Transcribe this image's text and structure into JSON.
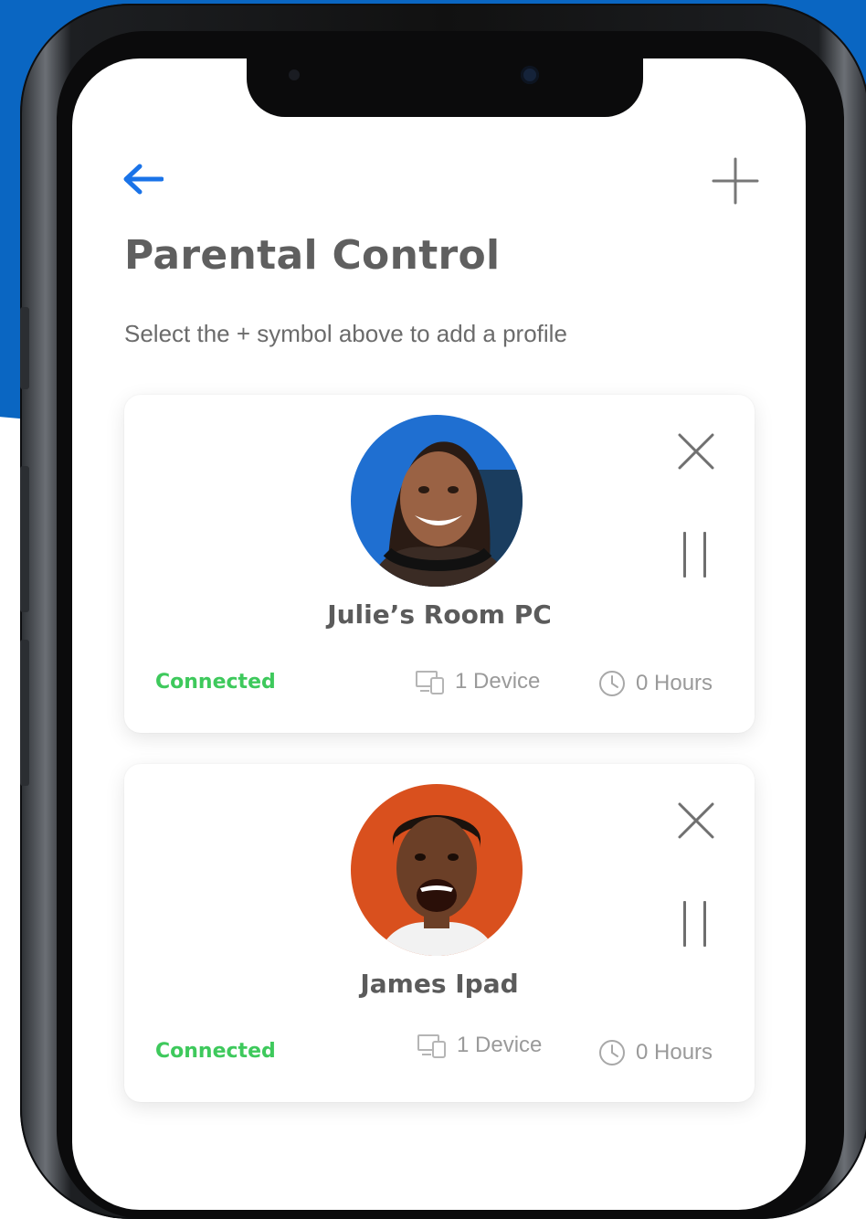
{
  "header": {
    "back_icon": "arrow-left-icon",
    "add_icon": "plus-icon",
    "title": "Parental Control",
    "subtitle": "Select the + symbol above to add a profile"
  },
  "colors": {
    "accent": "#1a73e8",
    "connected": "#3ec95c",
    "brand_background": "#0a66c2"
  },
  "profiles": [
    {
      "name": "Julie’s Room PC",
      "status": "Connected",
      "devices": "1 Device",
      "hours": "0 Hours",
      "avatar_bg": "#1f6fd1"
    },
    {
      "name": "James Ipad",
      "status": "Connected",
      "devices": "1 Device",
      "hours": "0 Hours",
      "avatar_bg": "#d9501e"
    }
  ]
}
